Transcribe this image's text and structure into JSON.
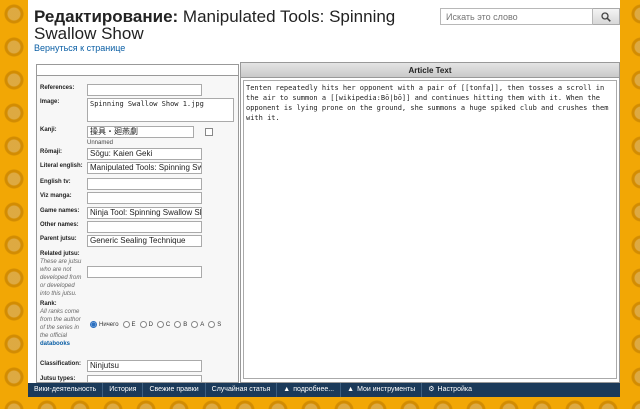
{
  "header": {
    "title_bold": "Редактирование:",
    "title_rest": "Manipulated Tools: Spinning Swallow Show",
    "back_link": "Вернуться к странице"
  },
  "search": {
    "placeholder": "Искать это слово"
  },
  "form": {
    "references_label": "References:",
    "image_label": "Image:",
    "image_value": "Spinning Swallow Show 1.jpg",
    "kanji_label": "Kanji:",
    "kanji_value": "操具・廻燕劇",
    "kanji_sub": "Unnamed",
    "romaji_label": "Rōmaji:",
    "romaji_value": "Sōgu: Kaien Geki",
    "literal_label": "Literal english:",
    "literal_value": "Manipulated Tools:  Spinning Sw",
    "english_tv_label": "English tv:",
    "viz_manga_label": "Viz manga:",
    "game_names_label": "Game names:",
    "game_names_value": "Ninja Tool: Spinning Swallow Sh",
    "other_names_label": "Other names:",
    "parent_jutsu_label": "Parent jutsu:",
    "parent_jutsu_value": "Generic Sealing Technique",
    "related_label": "Related jutsu:",
    "related_note": "These are jutsu who are not developed from or developed into this jutsu.",
    "rank_label": "Rank:",
    "rank_note_pre": "All ranks come from the author of the series in the official",
    "rank_note_link": "databooks",
    "rank_options": [
      "Ничего",
      "E",
      "D",
      "C",
      "B",
      "A",
      "S"
    ],
    "classification_label": "Classification:",
    "classification_value": "Ninjutsu",
    "jutsu_types_label": "Jutsu types:"
  },
  "article": {
    "header": "Article Text",
    "body": "Tenten repeatedly hits her opponent with a pair of [[tonfa]], then tosses a scroll in the air to summon a [[wikipedia:Bō|bō]] and continues hitting them with it. When the opponent is lying prone on the ground, she summons a huge spiked club and crushes them with it."
  },
  "footer": {
    "items": [
      "Вики-деятельность",
      "История",
      "Свежие правки",
      "Случайная статья",
      "подробнее...",
      "Мои инструменты",
      "Настройка"
    ]
  },
  "colors": {
    "background": "#f2a705",
    "footer": "#1b3a5a",
    "link": "#0b5fa5"
  }
}
